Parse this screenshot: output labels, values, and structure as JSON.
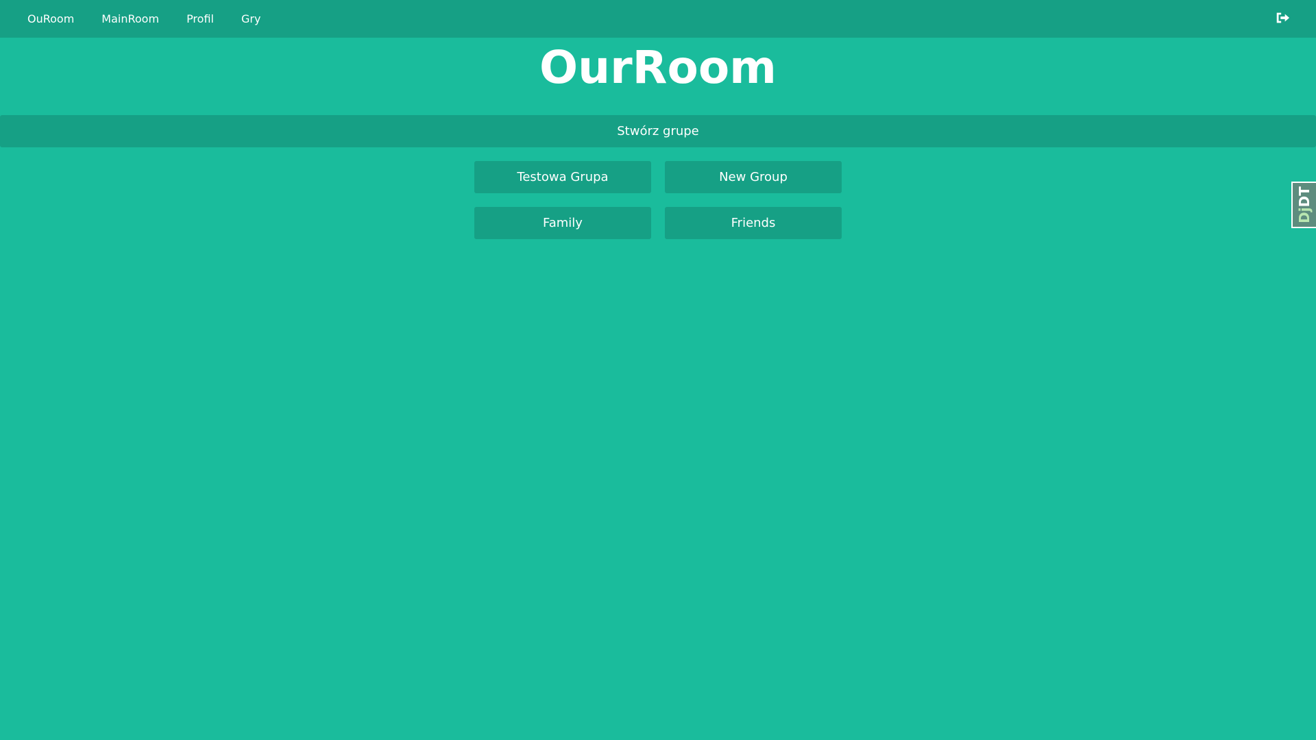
{
  "nav": {
    "links": [
      {
        "label": "OuRoom"
      },
      {
        "label": "MainRoom"
      },
      {
        "label": "Profil"
      },
      {
        "label": "Gry"
      }
    ],
    "logout_icon": "sign-out-icon"
  },
  "page_title": "OurRoom",
  "create_group_label": "Stwórz grupe",
  "groups": [
    {
      "label": "Testowa Grupa"
    },
    {
      "label": "New Group"
    },
    {
      "label": "Family"
    },
    {
      "label": "Friends"
    }
  ],
  "debug_toolbar": {
    "prefix": "Dj",
    "suffix": "DT"
  },
  "colors": {
    "background": "#1abc9c",
    "navbar": "#16a085",
    "text": "#ffffff"
  }
}
